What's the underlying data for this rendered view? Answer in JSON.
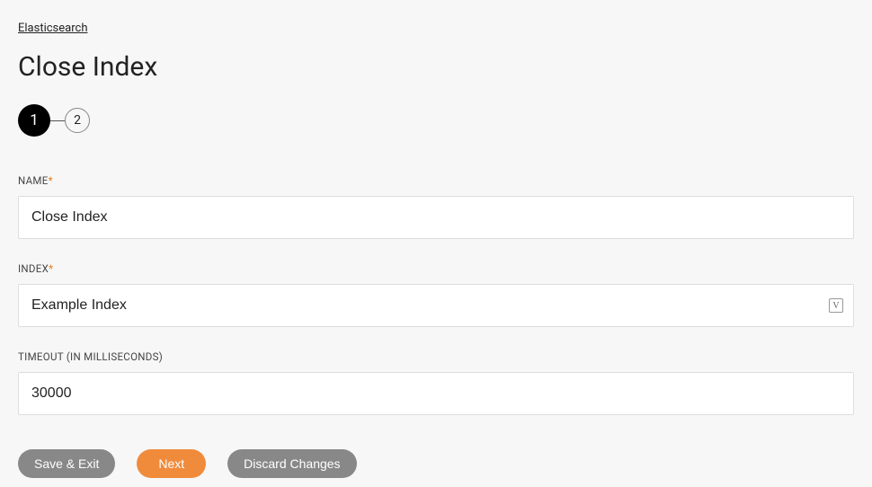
{
  "breadcrumb": "Elasticsearch",
  "pageTitle": "Close Index",
  "stepper": {
    "step1": "1",
    "step2": "2"
  },
  "form": {
    "name": {
      "label": "NAME",
      "value": "Close Index"
    },
    "index": {
      "label": "INDEX",
      "value": "Example Index"
    },
    "timeout": {
      "label": "TIMEOUT (IN MILLISECONDS)",
      "value": "30000"
    }
  },
  "buttons": {
    "saveExit": "Save & Exit",
    "next": "Next",
    "discard": "Discard Changes"
  },
  "icons": {
    "variable": "V"
  }
}
